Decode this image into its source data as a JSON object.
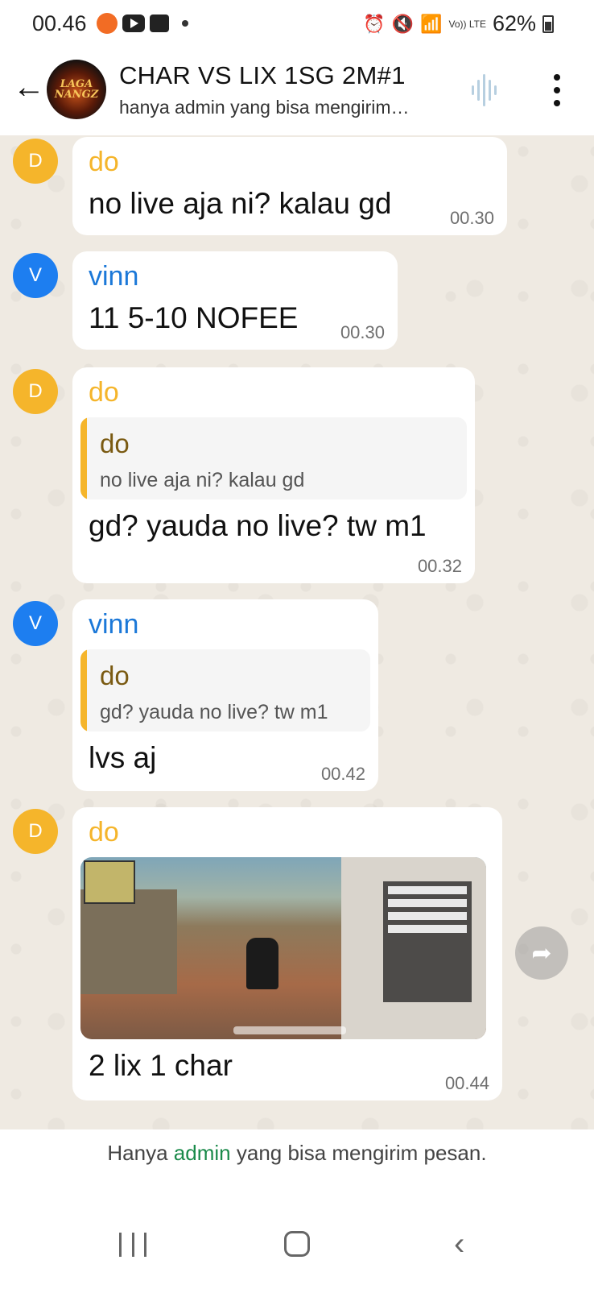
{
  "status_bar": {
    "time": "00.46",
    "battery": "62%",
    "net_label": "Vo)) LTE"
  },
  "header": {
    "group_name": "CHAR VS LIX 1SG 2M#1",
    "subtitle": "hanya admin yang bisa mengirim…",
    "avatar_text_line1": "LAGA",
    "avatar_text_line2": "NANGZ"
  },
  "messages": [
    {
      "avatar": "D",
      "sender": "do",
      "text": "no live aja ni? kalau gd",
      "time": "00.30"
    },
    {
      "avatar": "V",
      "sender": "vinn",
      "text": "11 5-10 NOFEE",
      "time": "00.30"
    },
    {
      "avatar": "D",
      "sender": "do",
      "quote_sender": "do",
      "quote_text": "no live aja ni? kalau gd",
      "text": "gd? yauda no live? tw m1",
      "time": "00.32"
    },
    {
      "avatar": "V",
      "sender": "vinn",
      "quote_sender": "do",
      "quote_text": "gd? yauda no live? tw m1",
      "text": "lvs aj",
      "time": "00.42"
    },
    {
      "avatar": "D",
      "sender": "do",
      "image": "game-screenshot",
      "text": "2 lix 1 char",
      "time": "00.44"
    }
  ],
  "footer": {
    "prefix": "Hanya",
    "admin": "admin",
    "suffix": "yang bisa mengirim pesan."
  },
  "colors": {
    "chat_bg": "#efeae2",
    "do_color": "#f5b52b",
    "vinn_color": "#1b78d8",
    "admin_link": "#1a8a4a"
  },
  "icons": [
    "back-arrow-icon",
    "voice-chat-icon",
    "more-menu-icon",
    "forward-icon",
    "nav-recents-icon",
    "nav-home-icon",
    "nav-back-icon"
  ]
}
